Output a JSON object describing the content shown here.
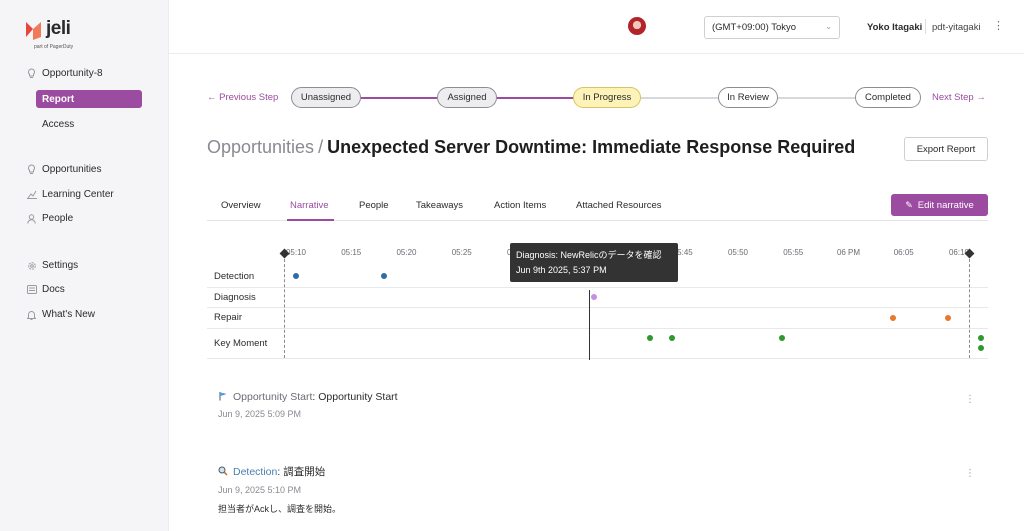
{
  "brand": {
    "name": "jeli",
    "tagline": "part of PagerDuty"
  },
  "sidebar": {
    "opportunity": "Opportunity-8",
    "sub_items": [
      "Report",
      "Access"
    ],
    "items": [
      {
        "label": "Opportunities",
        "icon": "bulb-icon"
      },
      {
        "label": "Learning Center",
        "icon": "chart-icon"
      },
      {
        "label": "People",
        "icon": "person-icon"
      }
    ],
    "bottom_items": [
      {
        "label": "Settings",
        "icon": "gear-icon"
      },
      {
        "label": "Docs",
        "icon": "docs-icon"
      },
      {
        "label": "What's New",
        "icon": "bell-icon"
      }
    ]
  },
  "topbar": {
    "timezone": "(GMT+09:00) Tokyo",
    "user_name": "Yoko Itagaki",
    "user_handle": "pdt-yitagaki"
  },
  "stepper": {
    "prev": "← Previous Step",
    "next": "Next Step →",
    "steps": [
      {
        "label": "Unassigned",
        "state": "done"
      },
      {
        "label": "Assigned",
        "state": "done"
      },
      {
        "label": "In Progress",
        "state": "current"
      },
      {
        "label": "In Review",
        "state": "todo"
      },
      {
        "label": "Completed",
        "state": "todo"
      }
    ]
  },
  "title": {
    "crumb": "Opportunities",
    "separator": "/",
    "main": "Unexpected Server Downtime: Immediate Response Required"
  },
  "export_label": "Export Report",
  "tabs": [
    "Overview",
    "Narrative",
    "People",
    "Takeaways",
    "Action Items",
    "Attached Resources"
  ],
  "active_tab": "Narrative",
  "edit_label": "Edit narrative",
  "timeline": {
    "rows": [
      "Detection",
      "Diagnosis",
      "Repair",
      "Key Moment"
    ],
    "ticks": [
      "05:10",
      "05:15",
      "05:20",
      "05:25",
      "05:30",
      "05:35",
      "05:40",
      "05:45",
      "05:50",
      "05:55",
      "06 PM",
      "06:05",
      "06:10"
    ],
    "tooltip": {
      "title": "Diagnosis: NewRelicのデータを確認",
      "time": "Jun 9th 2025, 5:37 PM"
    },
    "colors": {
      "Detection": "#2f6ea5",
      "Diagnosis": "#c48fe0",
      "Repair": "#e8782a",
      "Key Moment": "#2e9a2e"
    },
    "events": [
      {
        "row": "Detection",
        "time": "17:10"
      },
      {
        "row": "Detection",
        "time": "17:18"
      },
      {
        "row": "Diagnosis",
        "time": "17:37"
      },
      {
        "row": "Repair",
        "time": "18:04"
      },
      {
        "row": "Repair",
        "time": "18:09"
      },
      {
        "row": "Key Moment",
        "time": "17:42"
      },
      {
        "row": "Key Moment",
        "time": "17:44"
      },
      {
        "row": "Key Moment",
        "time": "17:54"
      },
      {
        "row": "Key Moment",
        "time": "18:12"
      },
      {
        "row": "Key Moment",
        "time": "18:12"
      }
    ]
  },
  "events": [
    {
      "icon": "flag-icon",
      "type": "Opportunity Start",
      "title": "Opportunity Start",
      "time": "Jun 9, 2025 5:09 PM",
      "body": ""
    },
    {
      "icon": "magnifier-icon",
      "type": "Detection",
      "title": "調査開始",
      "time": "Jun 9, 2025 5:10 PM",
      "body": "担当者がAckし、調査を開始。"
    }
  ]
}
